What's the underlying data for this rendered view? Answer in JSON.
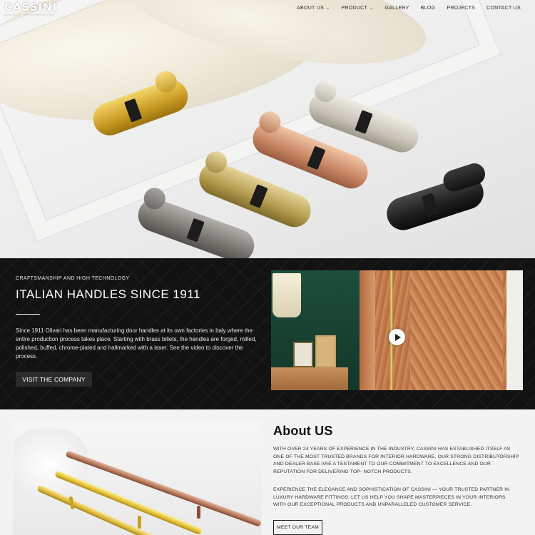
{
  "brand": {
    "name": "CASSINI",
    "tagline": "SHAPING MASTERPIECES"
  },
  "nav": {
    "items": [
      {
        "label": "ABOUT US",
        "has_dropdown": true
      },
      {
        "label": "PRODUCT",
        "has_dropdown": true
      },
      {
        "label": "GALLERY",
        "has_dropdown": false
      },
      {
        "label": "BLOG",
        "has_dropdown": false
      },
      {
        "label": "PROJECTS",
        "has_dropdown": false
      },
      {
        "label": "CONTACT US",
        "has_dropdown": false
      }
    ],
    "dropdown_glyph": "⌄"
  },
  "hero": {
    "image_subject": "door lock cylinders in gold, nickel, rose gold, antique brass, gunmetal and black finishes"
  },
  "heritage": {
    "eyebrow": "CRAFTSMANSHIP AND HIGH TECHNOLOGY",
    "title": "ITALIAN HANDLES SINCE 1911",
    "body": "Since 1911 Olivari has been manufacturing door handles at its own factories in Italy where the entire production process takes place. Starting with brass billets, the handles are forged, milled, polished, buffed, chrome-plated and hallmarked with a laser. See the video to discover the process.",
    "button_label": "VISIT THE COMPANY",
    "video": {
      "icon": "play-icon"
    }
  },
  "about": {
    "title": "About US",
    "paragraph1": "WITH OVER 24 YEARS OF EXPERIENCE IN THE INDUSTRY, CASSINI HAS ESTABLISHED ITSELF AS ONE OF THE MOST TRUSTED BRANDS FOR INTERIOR HARDWARE. OUR STRONG DISTRIBUTORSHIP AND DEALER BASE ARE A TESTAMENT TO OUR COMMITMENT TO EXCELLENCE AND OUR REPUTATION FOR DELIVERING TOP- NOTCH PRODUCTS.",
    "paragraph2": "EXPERIENCE THE ELEGANCE AND SOPHISTICATION OF CASSINI — YOUR TRUSTED PARTNER IN LUXURY HARDWARE FITTINGS. LET US HELP YOU SHAPE MASTERPIECES IN YOUR INTERIORS WITH OUR EXCEPTIONAL PRODUCTS AND UNPARALLELED CUSTOMER SERVICE.",
    "button_label": "MEET OUR TEAM"
  },
  "colors": {
    "dark_section": "#121212",
    "button_dark": "#2b2b2b",
    "about_bg": "#f3f3f3",
    "gold": "#d8b225",
    "copper": "#a86a4f"
  }
}
